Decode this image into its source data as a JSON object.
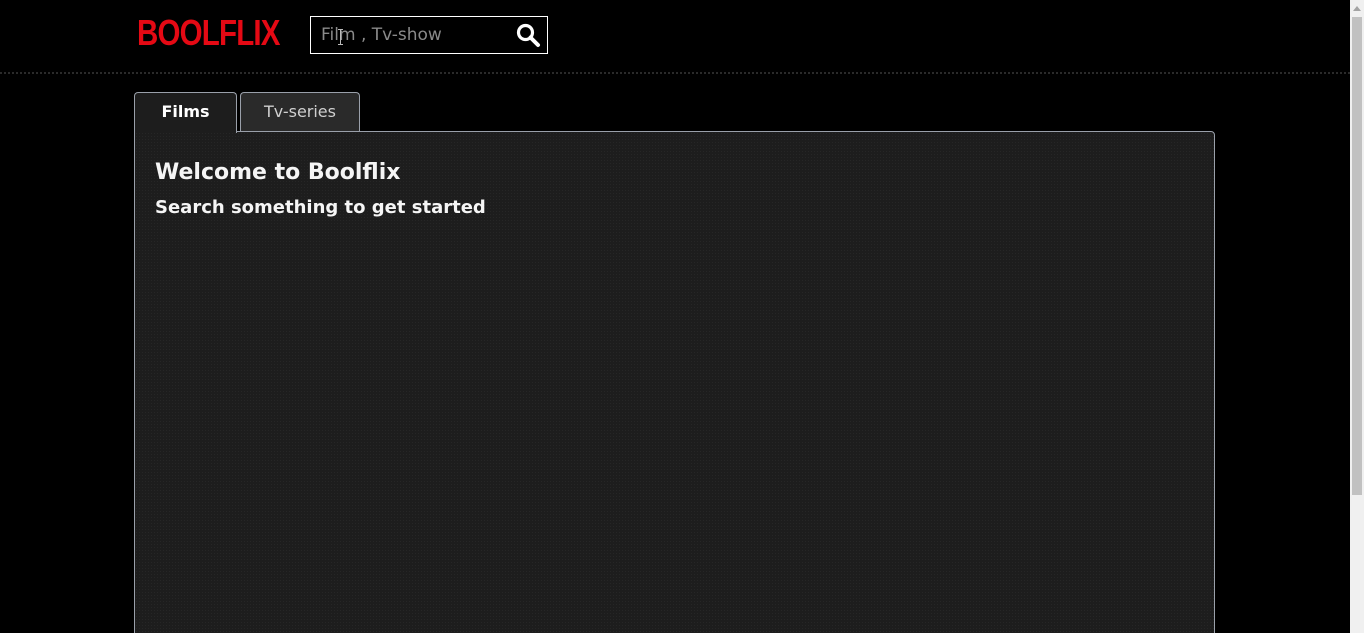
{
  "header": {
    "logo_text": "BOOLFLIX",
    "brand_color": "#e50914"
  },
  "search": {
    "placeholder": "Film , Tv-show",
    "value": "",
    "icon": "search-icon"
  },
  "tabs": [
    {
      "label": "Films",
      "active": true
    },
    {
      "label": "Tv-series",
      "active": false
    }
  ],
  "main": {
    "title": "Welcome to Boolflix",
    "subtitle": "Search something to get started"
  }
}
